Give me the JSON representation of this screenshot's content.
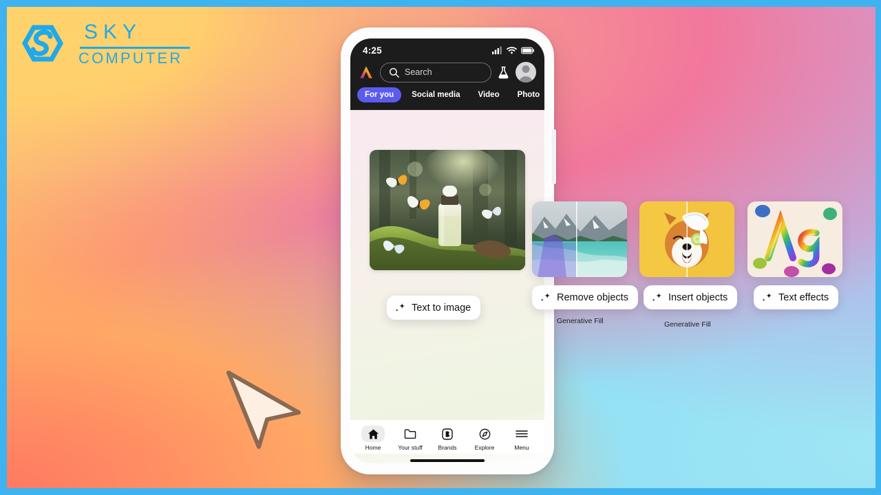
{
  "frame": {
    "border_color": "#3fb3ef"
  },
  "watermark": {
    "name": "SKY COMPUTER",
    "line1": "SKY",
    "line2": "COMPUTER",
    "color": "#20a9e8",
    "mark_icon": "sky-s-hexagon-logo"
  },
  "cursor": {
    "icon": "mouse-pointer-arrow"
  },
  "phone": {
    "status_bar": {
      "time": "4:25",
      "icons": [
        "cellular-signal-icon",
        "wifi-icon",
        "battery-icon"
      ]
    },
    "header": {
      "brand_icon": "adobe-express-logo",
      "search": {
        "placeholder": "Search",
        "icon": "search-icon"
      },
      "lab_icon": "flask-icon",
      "avatar_icon": "user-avatar-icon"
    },
    "tabs": [
      {
        "label": "For you",
        "active": true
      },
      {
        "label": "Social media",
        "active": false
      },
      {
        "label": "Video",
        "active": false
      },
      {
        "label": "Photo",
        "active": false
      }
    ],
    "hero": {
      "alt": "serum-bottle-on-moss-with-butterflies"
    },
    "bottom_nav": [
      {
        "label": "Home",
        "icon": "home-icon",
        "active": true
      },
      {
        "label": "Your stuff",
        "icon": "folder-icon",
        "active": false
      },
      {
        "label": "Brands",
        "icon": "brands-b-icon",
        "active": false
      },
      {
        "label": "Explore",
        "icon": "compass-icon",
        "active": false
      },
      {
        "label": "Menu",
        "icon": "hamburger-menu-icon",
        "active": false
      }
    ]
  },
  "features": [
    {
      "label": "Text to image",
      "icon": "ai-sparkle-icon",
      "caption": "",
      "thumb": ""
    },
    {
      "label": "Remove objects",
      "icon": "ai-sparkle-icon",
      "caption": "Generative Fill",
      "thumb": "mountain-lake-before-after"
    },
    {
      "label": "Insert objects",
      "icon": "ai-sparkle-icon",
      "caption": "Generative Fill",
      "thumb": "shiba-dog-spa-towel"
    },
    {
      "label": "Text effects",
      "icon": "ai-sparkle-icon",
      "caption": "",
      "thumb": "rainbow-Ag-lettering"
    }
  ]
}
